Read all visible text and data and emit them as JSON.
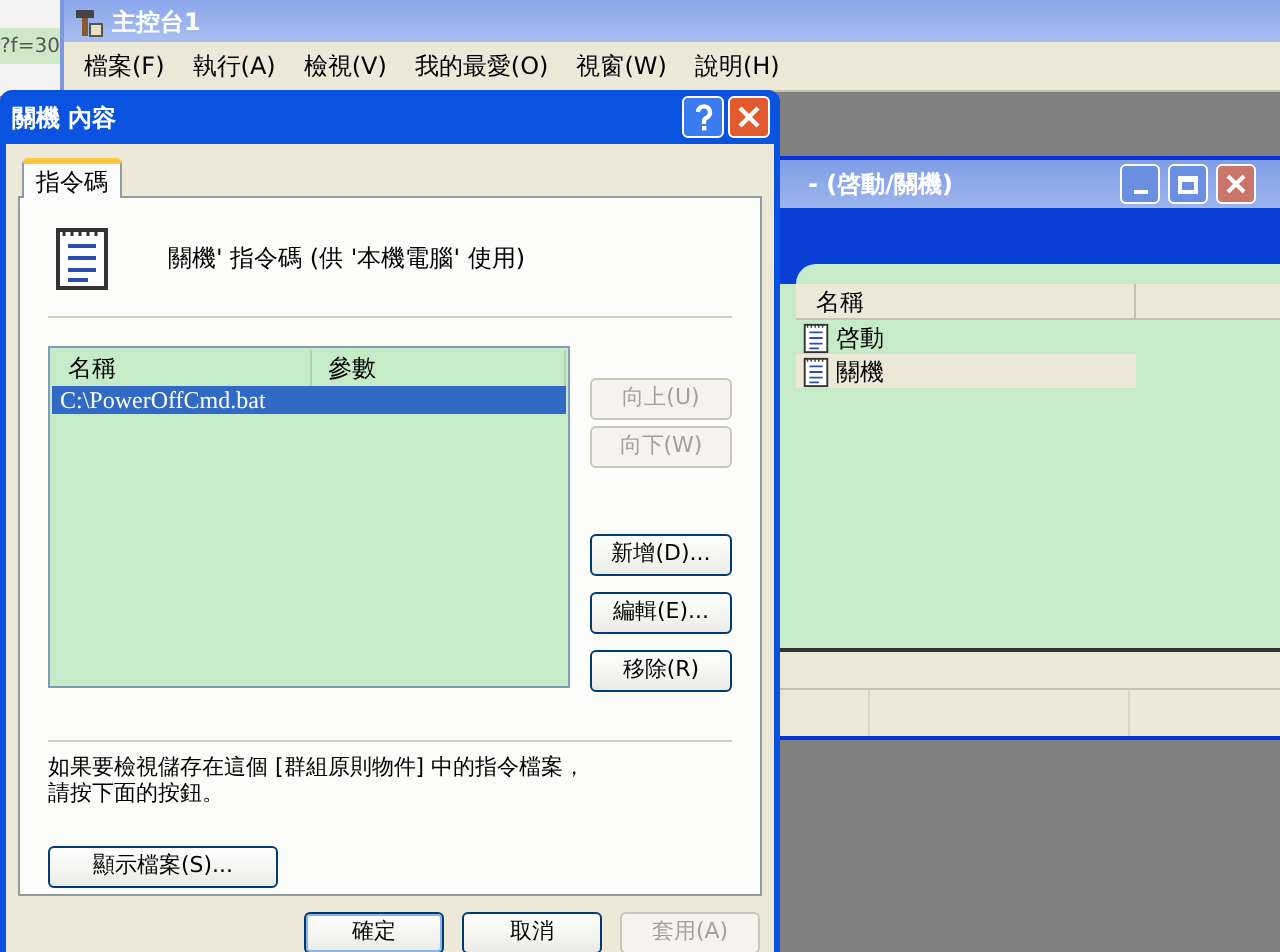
{
  "edge_window": {
    "text": "?f=30"
  },
  "console": {
    "title": "主控台1",
    "menu": [
      "檔案(F)",
      "執行(A)",
      "檢視(V)",
      "我的最愛(O)",
      "視窗(W)",
      "說明(H)"
    ]
  },
  "child_window": {
    "title": "- (啓動/關機)",
    "column": "名稱",
    "items": [
      {
        "label": "啓動",
        "selected": false
      },
      {
        "label": "關機",
        "selected": true
      }
    ]
  },
  "dialog": {
    "title": "關機 內容",
    "tabs": [
      {
        "label": "指令碼",
        "selected": true
      }
    ],
    "heading": "關機' 指令碼 (供 '本機電腦' 使用)",
    "list": {
      "columns": [
        "名稱",
        "參數"
      ],
      "rows": [
        {
          "name": "C:\\PowerOffCmd.bat",
          "selected": true
        }
      ]
    },
    "side_buttons": [
      {
        "label": "向上(U)",
        "disabled": true
      },
      {
        "label": "向下(W)",
        "disabled": true
      },
      {
        "label": "新增(D)...",
        "disabled": false
      },
      {
        "label": "編輯(E)...",
        "disabled": false
      },
      {
        "label": "移除(R)",
        "disabled": false
      }
    ],
    "note_lines": [
      "如果要檢視儲存在這個 [群組原則物件] 中的指令檔案，",
      "請按下面的按鈕。"
    ],
    "show_files_button": "顯示檔案(S)...",
    "buttons": [
      {
        "label": "確定",
        "disabled": false,
        "default": true
      },
      {
        "label": "取消",
        "disabled": false,
        "default": false
      },
      {
        "label": "套用(A)",
        "disabled": true,
        "default": false
      }
    ]
  }
}
